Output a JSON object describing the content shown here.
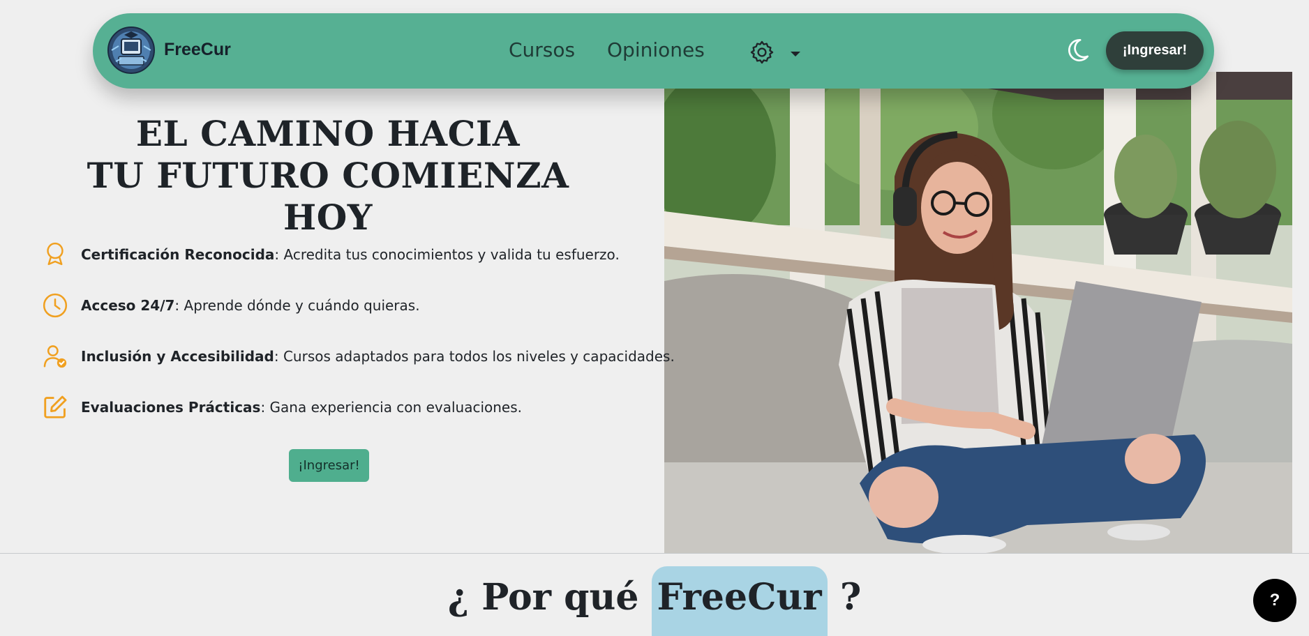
{
  "navbar": {
    "brand": "FreeCur",
    "links": [
      {
        "label": "Cursos"
      },
      {
        "label": "Opiniones"
      }
    ],
    "login_label": "¡Ingresar!",
    "settings_icon": "gear-icon",
    "theme_icon": "moon-icon"
  },
  "hero": {
    "title_line1": "EL CAMINO HACIA",
    "title_line2": "TU FUTURO COMIENZA HOY",
    "features": [
      {
        "icon": "award-icon",
        "bold": "Certificación Reconocida",
        "text": ": Acredita tus conocimientos y valida tu esfuerzo."
      },
      {
        "icon": "clock-icon",
        "bold": "Acceso 24/7",
        "text": ": Aprende dónde y cuándo quieras."
      },
      {
        "icon": "user-check-icon",
        "bold": "Inclusión y Accesibilidad",
        "text": ": Cursos adaptados para todos los niveles y capacidades."
      },
      {
        "icon": "edit-icon",
        "bold": "Evaluaciones Prácticas",
        "text": ": Gana experiencia con evaluaciones."
      }
    ],
    "cta_label": "¡Ingresar!"
  },
  "why": {
    "prefix": "¿ Por qué",
    "highlight": "FreeCur",
    "suffix": "?"
  },
  "help": {
    "label": "?"
  },
  "colors": {
    "navbar_bg": "#56b093",
    "accent_icon": "#f0a020",
    "highlight_bg": "#a9d4e4",
    "login_bg": "#2f3f3a"
  }
}
